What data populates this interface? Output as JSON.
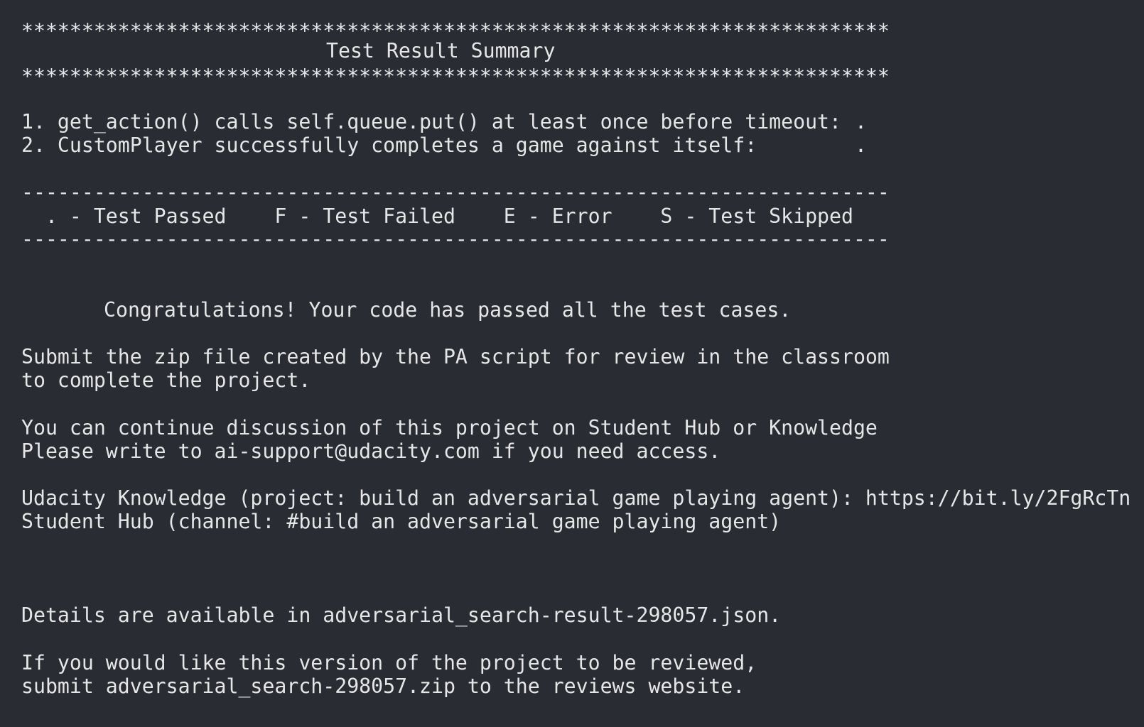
{
  "terminal": {
    "stars_top": "************************************************************************",
    "title": "Test Result Summary",
    "stars_bottom": "************************************************************************",
    "test_results": [
      {
        "text": "1. get_action() calls self.queue.put() at least once before timeout:",
        "status": "."
      },
      {
        "text": "2. CustomPlayer successfully completes a game against itself:",
        "status": "."
      }
    ],
    "divider_top": "------------------------------------------------------------------------",
    "legend": "  . - Test Passed    F - Test Failed    E - Error    S - Test Skipped",
    "divider_bottom": "------------------------------------------------------------------------",
    "congrats": "Congratulations! Your code has passed all the test cases.",
    "submit_line1": "Submit the zip file created by the PA script for review in the classroom",
    "submit_line2": "to complete the project.",
    "discussion_line1": "You can continue discussion of this project on Student Hub or Knowledge",
    "discussion_line2": "Please write to ai-support@udacity.com if you need access.",
    "knowledge_line": "Udacity Knowledge (project: build an adversarial game playing agent): https://bit.ly/2FgRcTn",
    "hub_line": "Student Hub (channel: #build an adversarial game playing agent)",
    "details_line": "Details are available in adversarial_search-result-298057.json.",
    "review_line1": "If you would like this version of the project to be reviewed,",
    "review_line2": "submit adversarial_search-298057.zip to the reviews website."
  }
}
